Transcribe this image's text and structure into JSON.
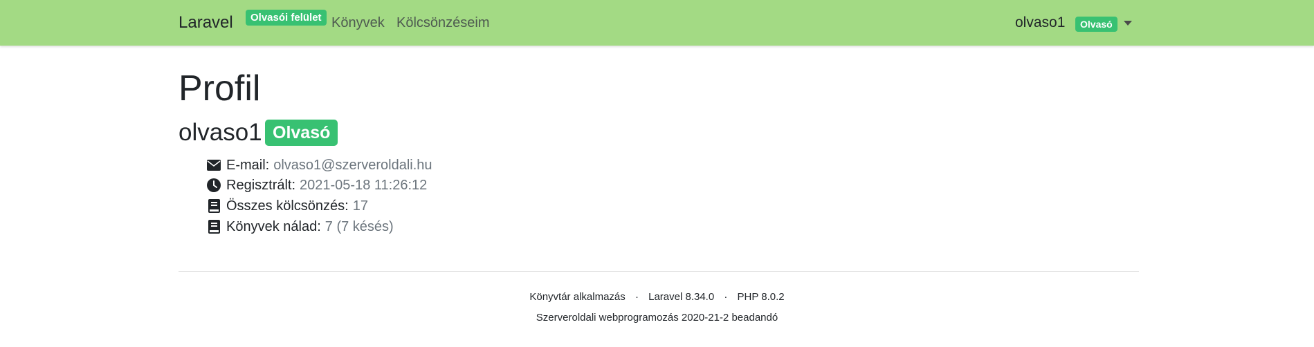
{
  "navbar": {
    "brand": "Laravel",
    "reader_badge": "Olvasói felület",
    "links": {
      "books": "Könyvek",
      "loans": "Kölcsönzéseim"
    },
    "user": {
      "name": "olvaso1",
      "role_badge": "Olvasó"
    },
    "colors": {
      "background": "#a3da84",
      "badge": "#38c172"
    }
  },
  "profile": {
    "title": "Profil",
    "username": "olvaso1",
    "role": "Olvasó",
    "details": {
      "email": {
        "icon": "envelope-icon",
        "label": "E-mail:",
        "value": "olvaso1@szerveroldali.hu"
      },
      "registered": {
        "icon": "clock-icon",
        "label": "Regisztrált:",
        "value": "2021-05-18 11:26:12"
      },
      "total_loans": {
        "icon": "book-icon",
        "label": "Összes kölcsönzés:",
        "value": "17"
      },
      "books_with_you": {
        "icon": "book-icon",
        "label": "Könyvek nálad:",
        "value": "7 (7 késés)"
      }
    }
  },
  "footer": {
    "app": "Könyvtár alkalmazás",
    "separator": "·",
    "laravel": "Laravel 8.34.0",
    "php": "PHP 8.0.2",
    "course": "Szerveroldali webprogramozás 2020-21-2 beadandó"
  }
}
